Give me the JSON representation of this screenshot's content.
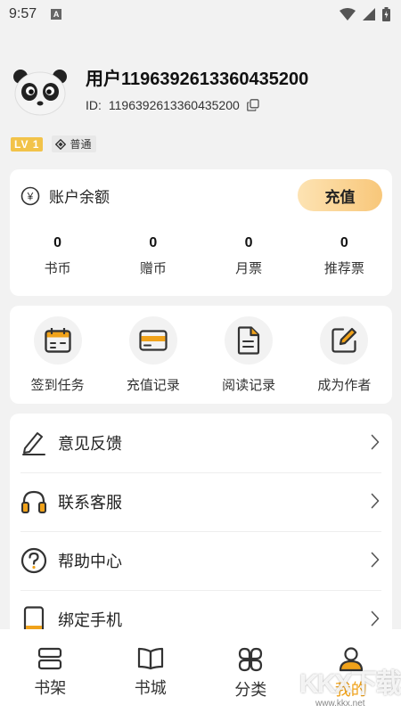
{
  "status_bar": {
    "time": "9:57",
    "notification_badge": "A"
  },
  "profile": {
    "username": "用户1196392613360435200",
    "id_label": "ID:",
    "id_value": "1196392613360435200",
    "level": "LV 1",
    "member_type": "普通"
  },
  "balance": {
    "title": "账户余额",
    "currency_symbol": "¥",
    "recharge_label": "充值",
    "stats": [
      {
        "value": "0",
        "label": "书币"
      },
      {
        "value": "0",
        "label": "赠币"
      },
      {
        "value": "0",
        "label": "月票"
      },
      {
        "value": "0",
        "label": "推荐票"
      }
    ]
  },
  "shortcuts": [
    {
      "label": "签到任务",
      "icon": "calendar-icon"
    },
    {
      "label": "充值记录",
      "icon": "card-icon"
    },
    {
      "label": "阅读记录",
      "icon": "document-icon"
    },
    {
      "label": "成为作者",
      "icon": "edit-icon"
    }
  ],
  "menu": [
    {
      "label": "意见反馈",
      "icon": "pencil-icon"
    },
    {
      "label": "联系客服",
      "icon": "headphones-icon"
    },
    {
      "label": "帮助中心",
      "icon": "question-icon"
    },
    {
      "label": "绑定手机",
      "icon": "phone-icon"
    }
  ],
  "tabs": [
    {
      "label": "书架",
      "icon": "bookshelf-icon",
      "active": false
    },
    {
      "label": "书城",
      "icon": "book-open-icon",
      "active": false
    },
    {
      "label": "分类",
      "icon": "category-icon",
      "active": false
    },
    {
      "label": "我的",
      "icon": "user-icon",
      "active": true
    }
  ],
  "watermark": {
    "text": "KKX下载",
    "url": "www.kkx.net"
  },
  "colors": {
    "accent": "#f0a21a",
    "recharge_gradient_start": "#fde3b3",
    "recharge_gradient_end": "#f8c77a",
    "level_badge": "#f2c34a"
  }
}
